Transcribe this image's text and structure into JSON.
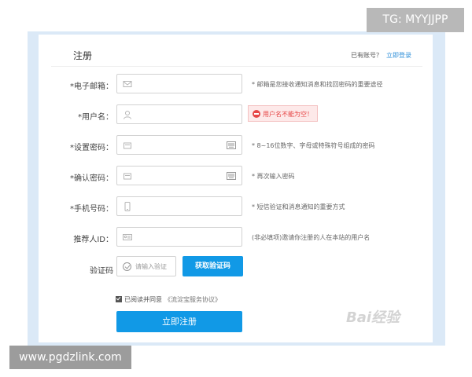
{
  "overlay": {
    "tg_tag": "TG: MYYJJPP",
    "url_watermark": "www.pgdzlink.com",
    "baidu_watermark": "Bai经验"
  },
  "header": {
    "title": "注册",
    "have_account": "已有账号？",
    "login_link": "立即登录"
  },
  "form": {
    "rows": [
      {
        "label": "*电子邮箱：",
        "hint": "* 邮箱是您接收通知消息和找回密码的重要途径"
      },
      {
        "label": "*用户名：",
        "hint": ""
      },
      {
        "label": "*设置密码：",
        "hint": "* 8~16位数字、字母或特殊符号组成的密码"
      },
      {
        "label": "*确认密码：",
        "hint": "* 再次输入密码"
      },
      {
        "label": "*手机号码：",
        "hint": "* 短信验证和消息通知的重要方式"
      },
      {
        "label": "推荐人ID：",
        "hint": "(非必填项)邀请你注册的人在本站的用户名"
      }
    ],
    "username_error": "用户名不能为空！",
    "captcha_label": "验证码",
    "captcha_placeholder": "请输入验证",
    "get_code_button": "获取验证码",
    "agree_text": "已阅读并同意",
    "agree_protocol": "《流淀宝服务协议》",
    "submit_button": "立即注册"
  },
  "colors": {
    "accent": "#1199e6",
    "error": "#e64545",
    "link": "#2e8fd9",
    "outer_panel": "#dbe9f7"
  }
}
